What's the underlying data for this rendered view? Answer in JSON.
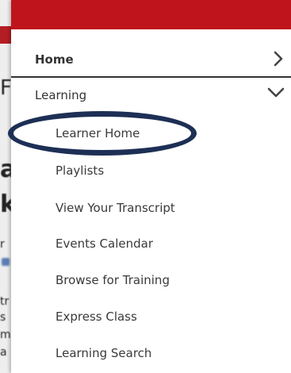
{
  "background": {
    "ghost_chars": [
      "F",
      "a",
      "k",
      "r",
      "tr",
      "s",
      "m",
      "a"
    ]
  },
  "colors": {
    "header_red": "#c0141c",
    "ring": "#1d2f55",
    "text": "#333333"
  },
  "menu": {
    "home": {
      "label": "Home",
      "icon": "chevron-right-icon"
    },
    "learning": {
      "label": "Learning",
      "icon": "chevron-down-icon",
      "items": [
        {
          "label": "Learner Home",
          "highlighted": true
        },
        {
          "label": "Playlists"
        },
        {
          "label": "View Your Transcript"
        },
        {
          "label": "Events Calendar"
        },
        {
          "label": "Browse for Training"
        },
        {
          "label": "Express Class"
        },
        {
          "label": "Learning Search"
        }
      ]
    }
  }
}
